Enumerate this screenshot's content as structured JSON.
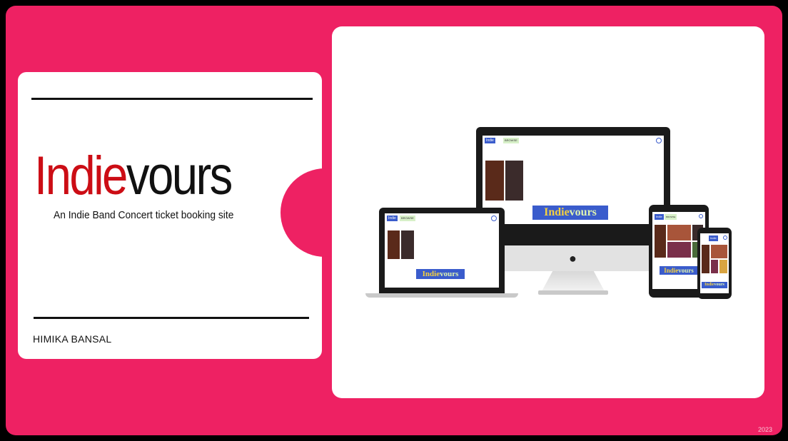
{
  "title": {
    "part1": "Indie",
    "part2": "vours"
  },
  "subtitle": "An Indie Band Concert ticket booking site",
  "author": "HIMIKA BANSAL",
  "year": "2023",
  "colors": {
    "background": "#ee2163",
    "title_accent": "#cc0d15",
    "title_dark": "#111111",
    "brand_bg": "#3a5ccc",
    "brand_text": "#f4d03f"
  },
  "mockup": {
    "nav_logo": "Indie",
    "nav_browse": "BROWSE",
    "brand_part1": "Indie",
    "brand_part2": "vours",
    "icons": [
      "user-icon",
      "apple-logo-icon"
    ]
  }
}
